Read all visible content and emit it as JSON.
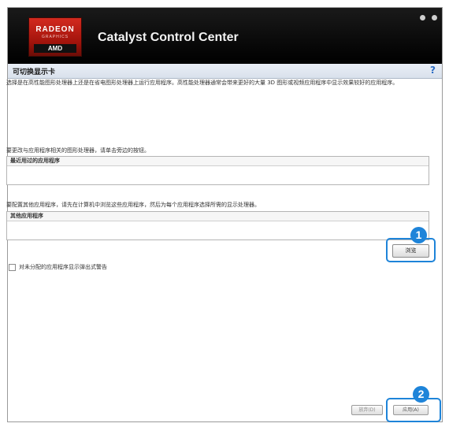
{
  "window": {
    "logo": {
      "brand": "RADEON",
      "sub": "GRAPHICS",
      "amd": "AMD"
    },
    "title": "Catalyst Control Center"
  },
  "section": {
    "title": "可切换显示卡",
    "help": "?"
  },
  "content": {
    "description": "选择是在高性能图形处理器上还是在省电图形处理器上运行应用程序。高性能处理器通常会带来更好的大量 3D 图形或视频应用程序中显示效果较好的应用程序。",
    "recent_label": "要更改与应用程序相关的图形处理器，请单击旁边的按钮。",
    "recent_header": "最近用过的应用程序",
    "other_label": "要配置其他应用程序，请先在计算机中浏览这些应用程序，然后为每个应用程序选择所需的显示处理器。",
    "other_header": "其他应用程序",
    "browse_button": "浏览",
    "checkbox_label": "对未分配的应用程序显示弹出式警告"
  },
  "footer": {
    "discard_button": "放弃(D)",
    "apply_button": "应用(A)"
  },
  "annotations": {
    "badge_1": "1",
    "badge_2": "2"
  },
  "colors": {
    "accent": "#1e84d9",
    "header_bg": "#0b0b0b",
    "logo_red": "#c0201a"
  }
}
